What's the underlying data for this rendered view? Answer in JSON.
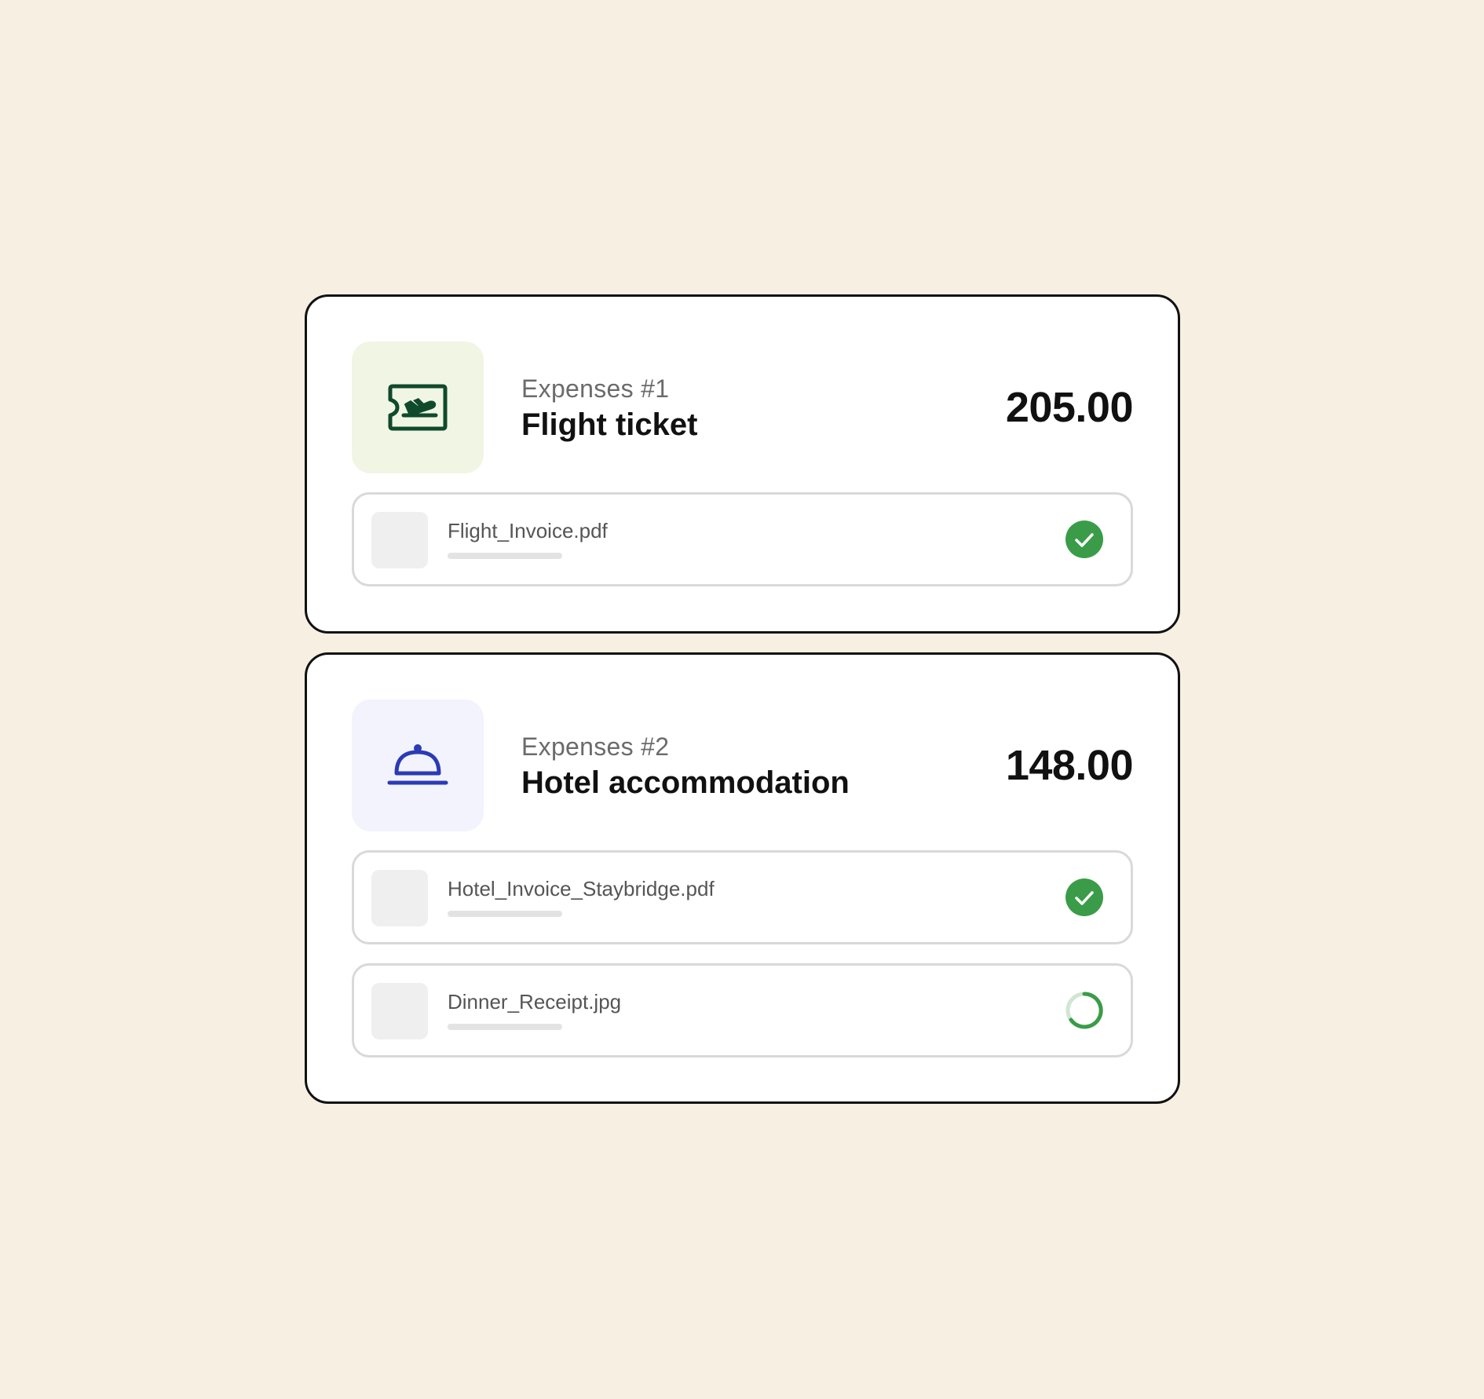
{
  "colors": {
    "background": "#f6efe2",
    "flight_tile_bg": "#f1f5e4",
    "flight_icon": "#0f4a2c",
    "hotel_tile_bg": "#f2f3fd",
    "hotel_icon": "#2b3bb5",
    "status_done": "#3a9c48",
    "status_loading_track": "#cfe6d3"
  },
  "expenses": [
    {
      "number_label": "Expenses #1",
      "title": "Flight ticket",
      "amount": "205.00",
      "icon": "plane-ticket-icon",
      "attachments": [
        {
          "file_name": "Flight_Invoice.pdf",
          "status": "uploaded"
        }
      ]
    },
    {
      "number_label": "Expenses #2",
      "title": "Hotel accommodation",
      "amount": "148.00",
      "icon": "cloche-icon",
      "attachments": [
        {
          "file_name": "Hotel_Invoice_Staybridge.pdf",
          "status": "uploaded"
        },
        {
          "file_name": "Dinner_Receipt.jpg",
          "status": "uploading"
        }
      ]
    }
  ]
}
